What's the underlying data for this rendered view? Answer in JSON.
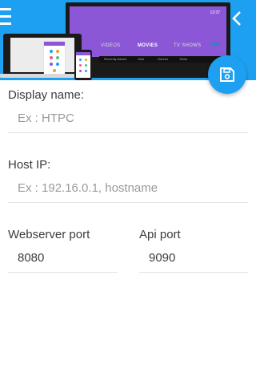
{
  "header": {
    "menu_icon": "menu-icon",
    "back_icon": "chevron-left-icon",
    "background_color": "#1da0f2"
  },
  "illustration": {
    "tv_time": "13:37",
    "tv_menu": [
      "VIDEOS",
      "MOVIES",
      "TV SHOWS"
    ],
    "tv_menu_active": "MOVIES",
    "tv_submenu": [
      "Recently Added",
      "Sets",
      "Genres",
      "Years"
    ],
    "accent_color": "#8b57d6"
  },
  "fab": {
    "icon": "save-icon"
  },
  "form": {
    "display_name": {
      "label": "Display name:",
      "placeholder": "Ex : HTPC",
      "value": ""
    },
    "host_ip": {
      "label": "Host IP:",
      "placeholder": "Ex : 192.16.0.1, hostname",
      "value": ""
    },
    "webserver_port": {
      "label": "Webserver port",
      "value": "8080"
    },
    "api_port": {
      "label": "Api port",
      "value": "9090"
    }
  }
}
